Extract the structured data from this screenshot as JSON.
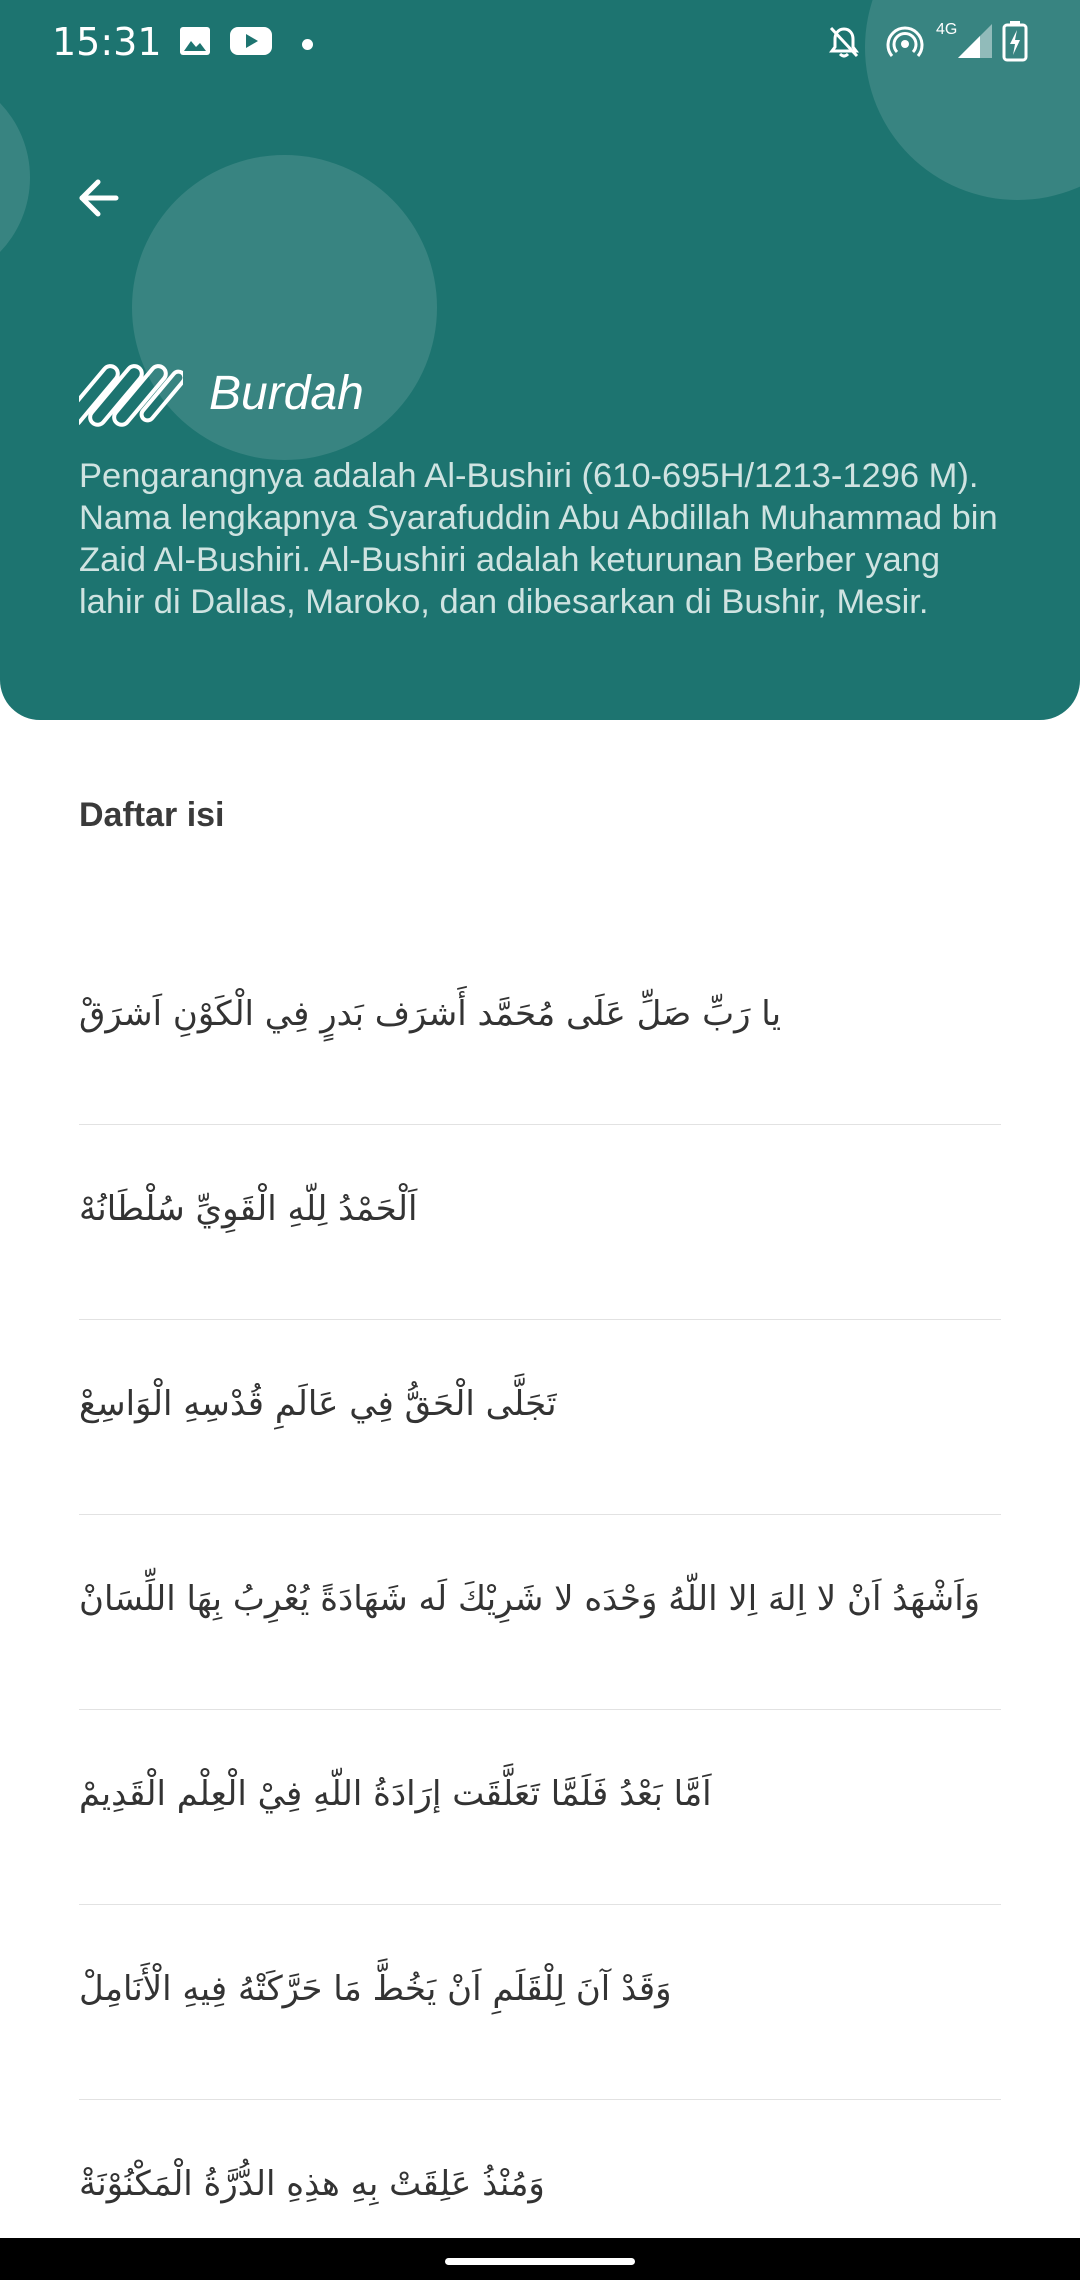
{
  "status_bar": {
    "time": "15:31",
    "network": "4G",
    "left_icons": [
      "image-icon",
      "youtube-icon",
      "notification-dot"
    ],
    "right_icons": [
      "bell-off-icon",
      "hotspot-icon",
      "signal-icon",
      "battery-charging-icon"
    ]
  },
  "header": {
    "color": "#1d7470",
    "back_icon": "arrow-left-icon",
    "logo_icon": "slash-lines-logo-icon",
    "title": "Burdah",
    "description": "Pengarangnya adalah Al-Bushiri (610-695H/1213-1296 M). Nama lengkapnya Syarafuddin Abu Abdillah Muhammad bin Zaid Al-Bushiri. Al-Bushiri adalah keturunan Berber yang lahir di Dallas, Maroko, dan dibesarkan di Bushir, Mesir."
  },
  "contents": {
    "title": "Daftar isi",
    "items": [
      "يا رَبِّ صَلِّ عَلَى مُحَمَّد أَشرَف بَدرٍ فِي الْكَوْنِ اَشرَقْ",
      "اَلْحَمْدُ لِلّهِ الْقَوِيِّ سُلْطَانُهْ",
      "تَجَلَّى الْحَقُّ فِي عَالَمِ قُدْسِهِ الْوَاسِعْ",
      "وَاَشْهَدُ اَنْ لا اِلهَ اِلا اللّهُ وَحْدَه لا شَرِيْكَ لَه شَهَادَةً يُعْرِبُ بِهَا اللِّسَانْ",
      "اَمَّا بَعْدُ فَلَمَّا تَعَلَّقَت إرَادَةُ اللّهِ فِيْ الْعِلْم الْقَدِيمْ",
      "وَقَدْ آنَ لِلْقَلَمِ اَنْ يَخُطَّ مَا حَرَّكَتْهُ فِيهِ الْأَنَامِلْ",
      "وَمُنْذُ عَلِقَتْ بِهِ هذِهِ الدُّرَّةُ الْمَكْنُوْنَةْ"
    ]
  }
}
